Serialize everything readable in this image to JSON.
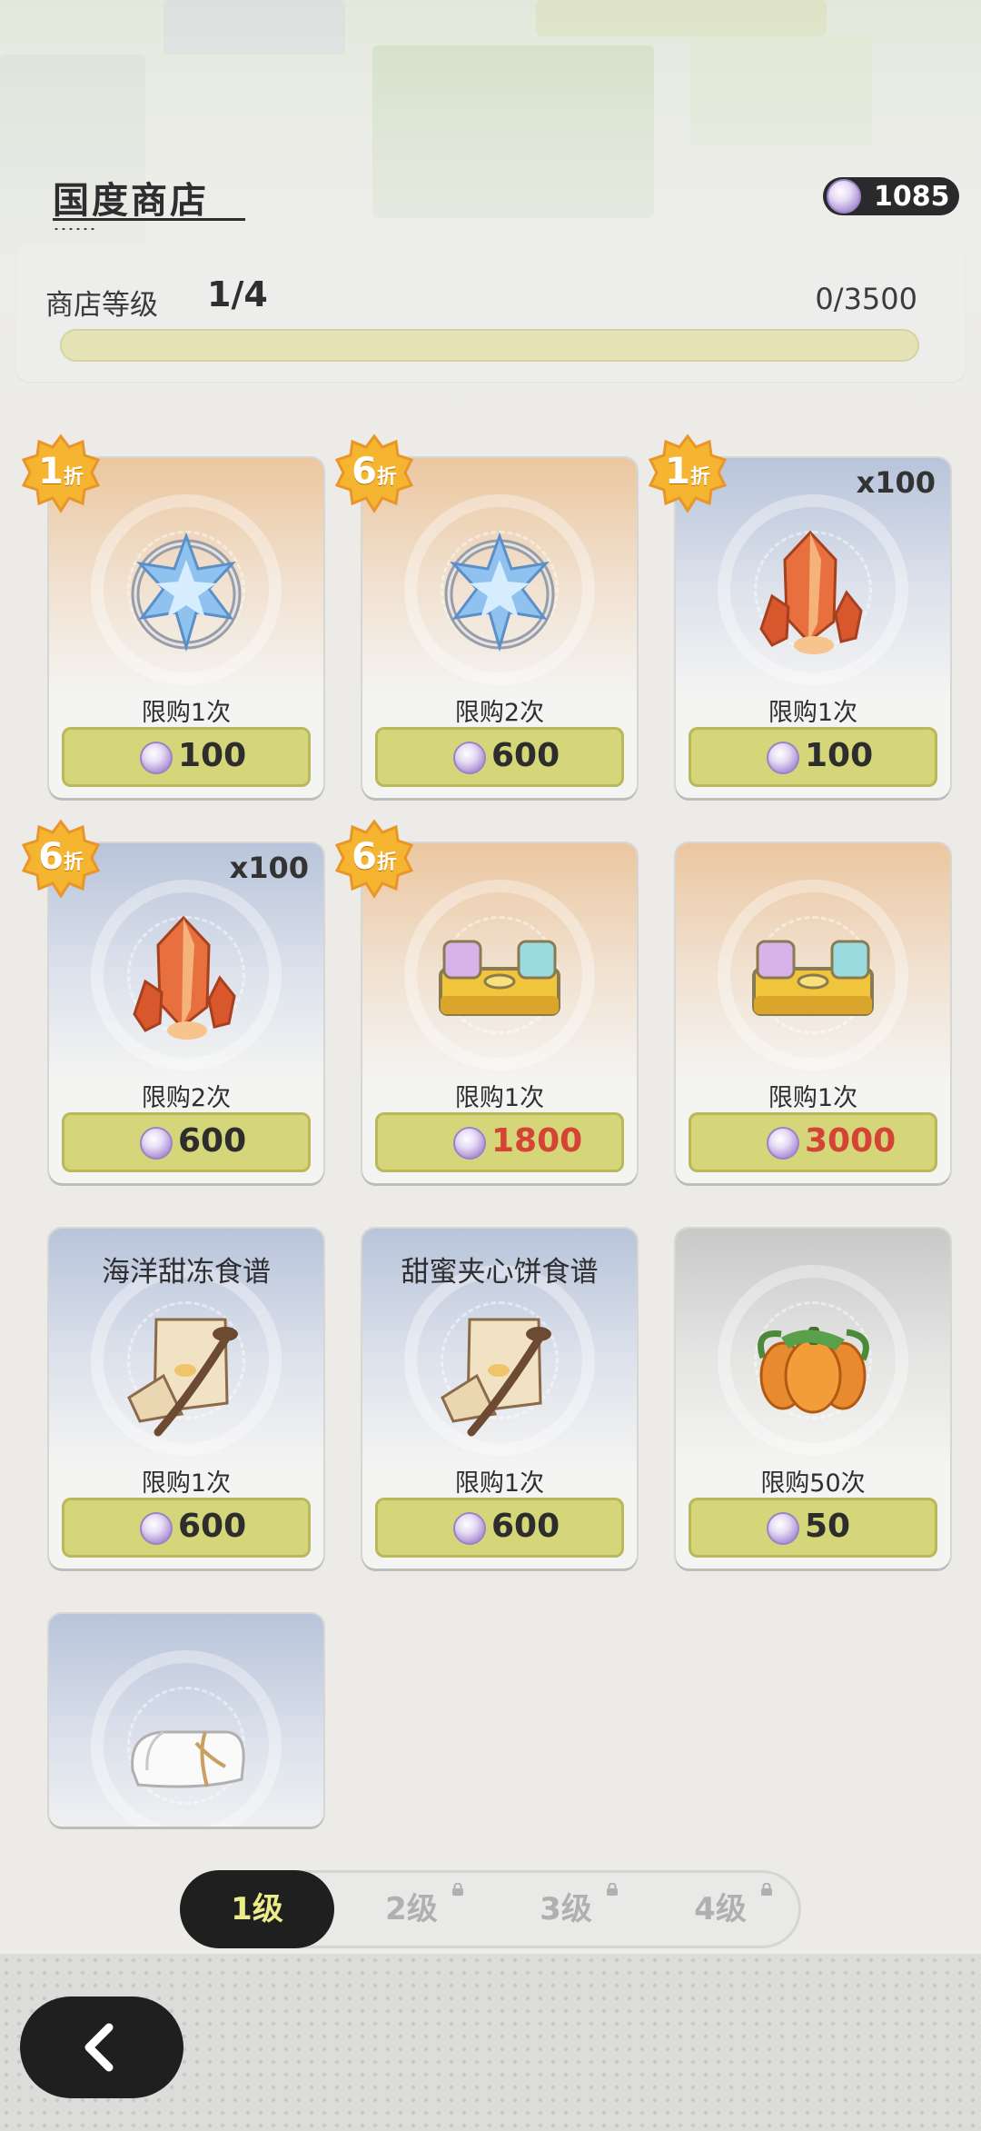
{
  "header": {
    "title": "国度商店",
    "currency": {
      "icon": "purple-coin-icon",
      "value": "1085"
    }
  },
  "level": {
    "label": "商店等级",
    "value": "1/4",
    "progress_text": "0/3500",
    "progress_fraction": 0
  },
  "items": [
    {
      "art": "frozen-star-icon",
      "theme": "orange",
      "discount": "1",
      "discount_unit": "折",
      "quantity": "",
      "name": "",
      "limit": "限购1次",
      "price": "100",
      "price_red": false
    },
    {
      "art": "frozen-star-icon",
      "theme": "orange",
      "discount": "6",
      "discount_unit": "折",
      "quantity": "",
      "name": "",
      "limit": "限购2次",
      "price": "600",
      "price_red": false
    },
    {
      "art": "amber-crystal-icon",
      "theme": "blue",
      "discount": "1",
      "discount_unit": "折",
      "quantity": "x100",
      "name": "",
      "limit": "限购1次",
      "price": "100",
      "price_red": false
    },
    {
      "art": "amber-crystal-icon",
      "theme": "blue",
      "discount": "6",
      "discount_unit": "折",
      "quantity": "x100",
      "name": "",
      "limit": "限购2次",
      "price": "600",
      "price_red": false
    },
    {
      "art": "block-platform-icon",
      "theme": "orange",
      "discount": "6",
      "discount_unit": "折",
      "quantity": "",
      "name": "",
      "limit": "限购1次",
      "price": "1800",
      "price_red": true
    },
    {
      "art": "block-platform-icon",
      "theme": "orange",
      "discount": "",
      "discount_unit": "",
      "quantity": "",
      "name": "",
      "limit": "限购1次",
      "price": "3000",
      "price_red": true
    },
    {
      "art": "recipe-scroll-icon",
      "theme": "blue",
      "discount": "",
      "discount_unit": "",
      "quantity": "",
      "name": "海洋甜冻食谱",
      "limit": "限购1次",
      "price": "600",
      "price_red": false
    },
    {
      "art": "recipe-scroll-icon",
      "theme": "blue",
      "discount": "",
      "discount_unit": "",
      "quantity": "",
      "name": "甜蜜夹心饼食谱",
      "limit": "限购1次",
      "price": "600",
      "price_red": false
    },
    {
      "art": "pumpkin-icon",
      "theme": "gray",
      "discount": "",
      "discount_unit": "",
      "quantity": "",
      "name": "",
      "limit": "限购50次",
      "price": "50",
      "price_red": false
    },
    {
      "art": "towel-icon",
      "theme": "blue",
      "discount": "",
      "discount_unit": "",
      "quantity": "",
      "name": "",
      "limit": "",
      "price": "",
      "price_red": false
    }
  ],
  "tabs": [
    {
      "label": "1级",
      "active": true,
      "locked": false
    },
    {
      "label": "2级",
      "active": false,
      "locked": true
    },
    {
      "label": "3级",
      "active": false,
      "locked": true
    },
    {
      "label": "4级",
      "active": false,
      "locked": true
    }
  ],
  "back_button": {
    "icon": "back-arrow-icon"
  }
}
